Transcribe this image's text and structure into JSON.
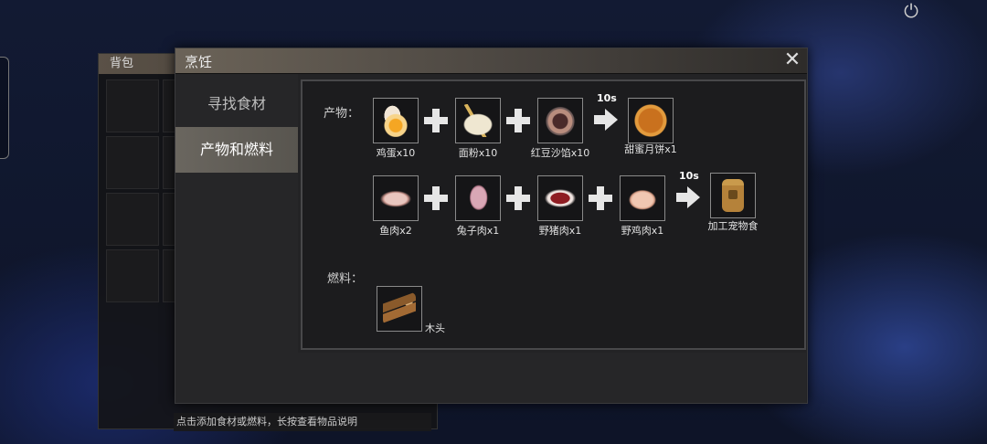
{
  "backpack": {
    "title": "背包"
  },
  "window": {
    "title": "烹饪",
    "close_symbol": "✕"
  },
  "tabs": [
    {
      "label": "寻找食材",
      "active": false
    },
    {
      "label": "产物和燃料",
      "active": true
    }
  ],
  "products_label": "产物：",
  "fuel_label": "燃料：",
  "recipes": [
    {
      "ingredients": [
        {
          "icon": "egg-icon",
          "caption": "鸡蛋x10"
        },
        {
          "icon": "flour-icon",
          "caption": "面粉x10"
        },
        {
          "icon": "red-bean-paste-icon",
          "caption": "红豆沙馅x10"
        }
      ],
      "time": "10s",
      "result": {
        "icon": "mooncake-icon",
        "caption": "甜蜜月饼x1"
      }
    },
    {
      "ingredients": [
        {
          "icon": "fish-meat-icon",
          "caption": "鱼肉x2"
        },
        {
          "icon": "rabbit-meat-icon",
          "caption": "兔子肉x1"
        },
        {
          "icon": "boar-meat-icon",
          "caption": "野猪肉x1"
        },
        {
          "icon": "pheasant-meat-icon",
          "caption": "野鸡肉x1"
        }
      ],
      "time": "10s",
      "result": {
        "icon": "pet-food-icon",
        "caption": "加工宠物食"
      }
    }
  ],
  "fuel": {
    "icon": "wood-icon",
    "caption": "木头"
  },
  "hint": "点击添加食材或燃料，长按查看物品说明",
  "colors": {
    "title_bar": "#6b6358",
    "active_tab": "#6a665f",
    "panel_bg": "#232325"
  }
}
